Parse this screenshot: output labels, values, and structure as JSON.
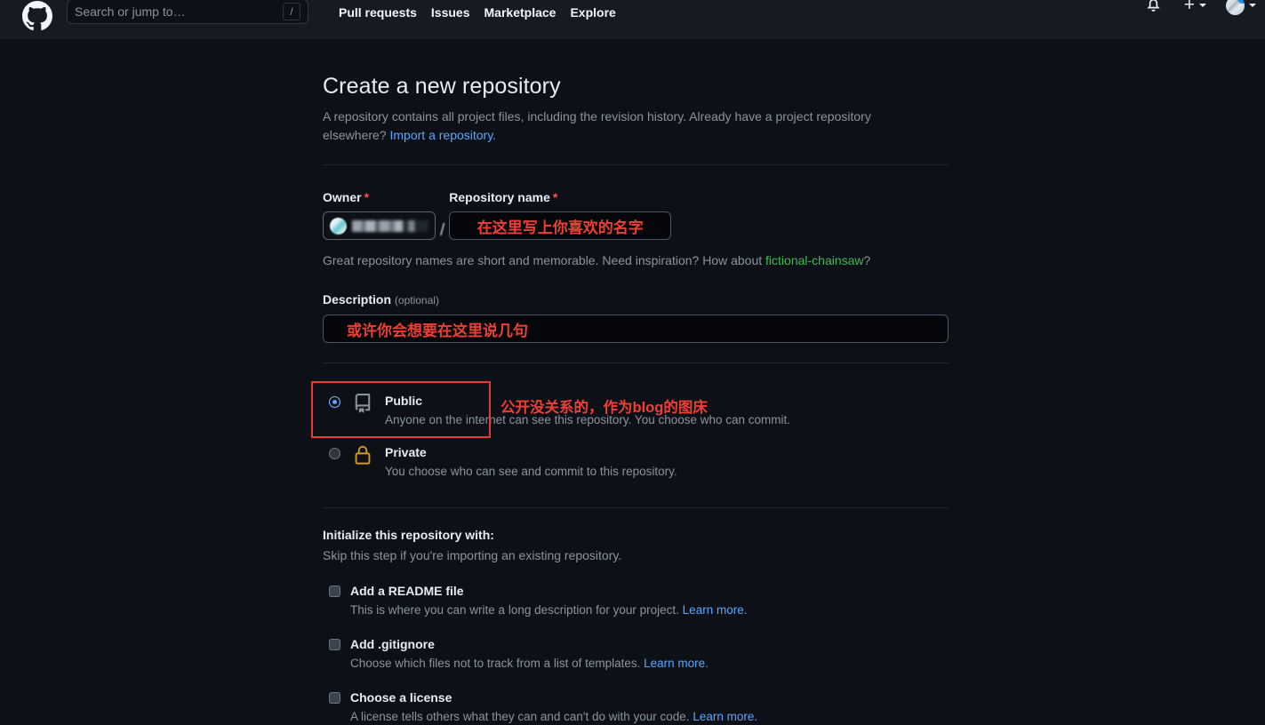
{
  "header": {
    "logo_name": "github-logo",
    "search": {
      "placeholder": "Search or jump to…",
      "shortcut": "/"
    },
    "nav": [
      {
        "label": "Pull requests"
      },
      {
        "label": "Issues"
      },
      {
        "label": "Marketplace"
      },
      {
        "label": "Explore"
      }
    ],
    "notifications_icon": "bell-icon",
    "create_new_icon": "plus-icon",
    "account_icon": "avatar"
  },
  "page": {
    "title": "Create a new repository",
    "subtitle_part1": "A repository contains all project files, including the revision history. Already have a project repository elsewhere? ",
    "subtitle_link": "Import a repository.",
    "owner": {
      "label": "Owner",
      "required_mark": "*",
      "value": "",
      "separator": "/"
    },
    "repo_name": {
      "label": "Repository name",
      "required_mark": "*",
      "value": "在这里写上你喜欢的名字",
      "placeholder": ""
    },
    "inspiration_prefix": "Great repository names are short and memorable. Need inspiration? How about ",
    "inspiration_suggestion": "fictional-chainsaw",
    "inspiration_suffix": "?",
    "description": {
      "label": "Description",
      "optional": "(optional)",
      "value": "或许你会想要在这里说几句",
      "placeholder": ""
    },
    "visibility": {
      "public": {
        "title": "Public",
        "description": "Anyone on the internet can see this repository. You choose who can commit.",
        "icon": "repo-book-icon",
        "selected": true
      },
      "private": {
        "title": "Private",
        "description": "You choose who can see and commit to this repository.",
        "icon": "lock-icon",
        "selected": false
      },
      "annotation": "公开没关系的，作为blog的图床"
    },
    "initialize": {
      "heading": "Initialize this repository with:",
      "subheading": "Skip this step if you're importing an existing repository.",
      "options": [
        {
          "title": "Add a README file",
          "desc_prefix": "This is where you can write a long description for your project. ",
          "link": "Learn more.",
          "checked": false
        },
        {
          "title": "Add .gitignore",
          "desc_prefix": "Choose which files not to track from a list of templates. ",
          "link": "Learn more.",
          "checked": false
        },
        {
          "title": "Choose a license",
          "desc_prefix": "A license tells others what they can and can't do with your code. ",
          "link": "Learn more.",
          "checked": false
        }
      ]
    }
  },
  "colors": {
    "page_bg": "#0d1117",
    "header_bg": "#161b22",
    "text_primary": "#e6edf3",
    "text_muted": "#8b949e",
    "link_blue": "#58a6ff",
    "required_red": "#f85149",
    "annotation_red": "#f03e35",
    "suggestion_green": "#3fb950",
    "lock_orange": "#d29922",
    "radio_blue": "#58a6ff"
  }
}
